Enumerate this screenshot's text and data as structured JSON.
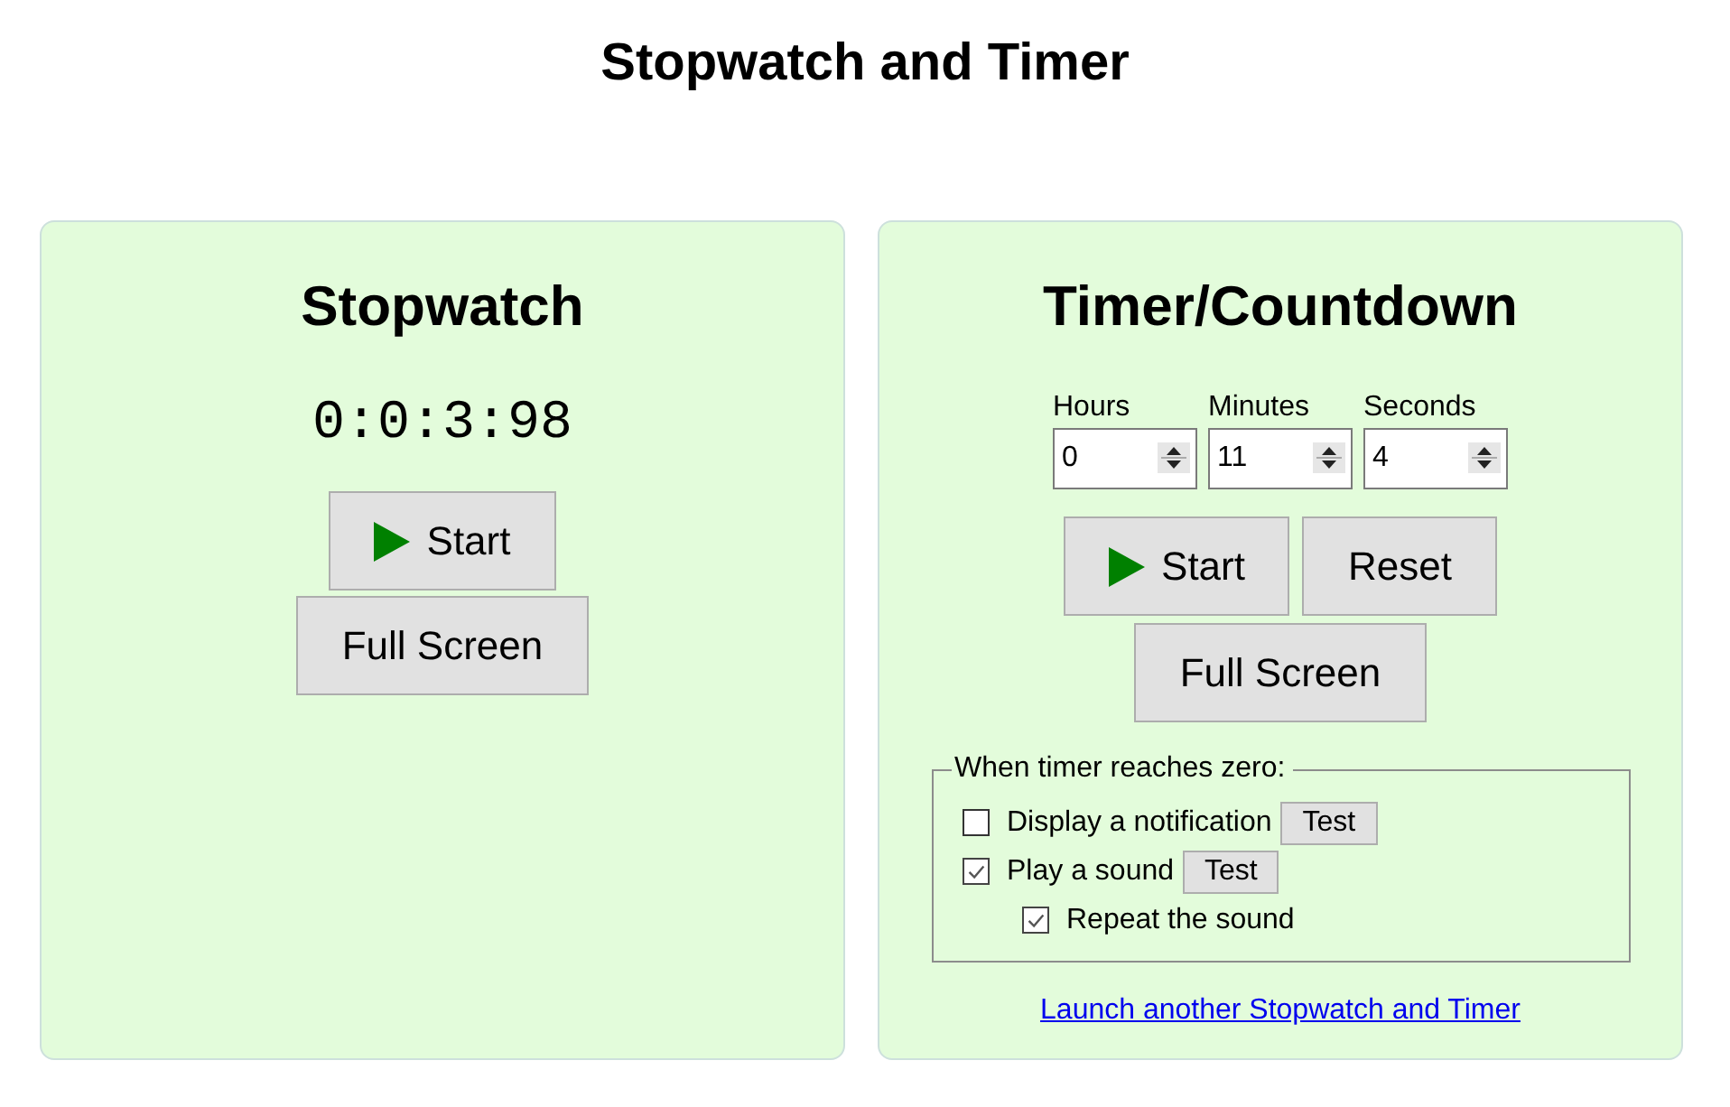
{
  "page": {
    "title": "Stopwatch and Timer"
  },
  "stopwatch": {
    "title": "Stopwatch",
    "display": "0:0:3:98",
    "button_rows": [
      [
        {
          "label": "Start",
          "kind": "play"
        }
      ],
      [
        {
          "label": "Full Screen",
          "kind": "plain"
        }
      ]
    ]
  },
  "timer": {
    "title": "Timer/Countdown",
    "fields": [
      {
        "label": "Hours",
        "value": "0"
      },
      {
        "label": "Minutes",
        "value": "11"
      },
      {
        "label": "Seconds",
        "value": "4"
      }
    ],
    "button_rows": [
      [
        {
          "label": "Start",
          "kind": "play"
        },
        {
          "label": "Reset",
          "kind": "plain"
        }
      ],
      [
        {
          "label": "Full Screen",
          "kind": "plain"
        }
      ]
    ],
    "alarm": {
      "legend": "When timer reaches zero:",
      "options": [
        {
          "label": "Display a notification",
          "checked": false,
          "test_button": "Test"
        },
        {
          "label": "Play a sound",
          "checked": true,
          "test_button": "Test",
          "children": [
            {
              "label": "Repeat the sound",
              "checked": true
            }
          ]
        }
      ]
    },
    "link": "Launch another Stopwatch and Timer"
  }
}
